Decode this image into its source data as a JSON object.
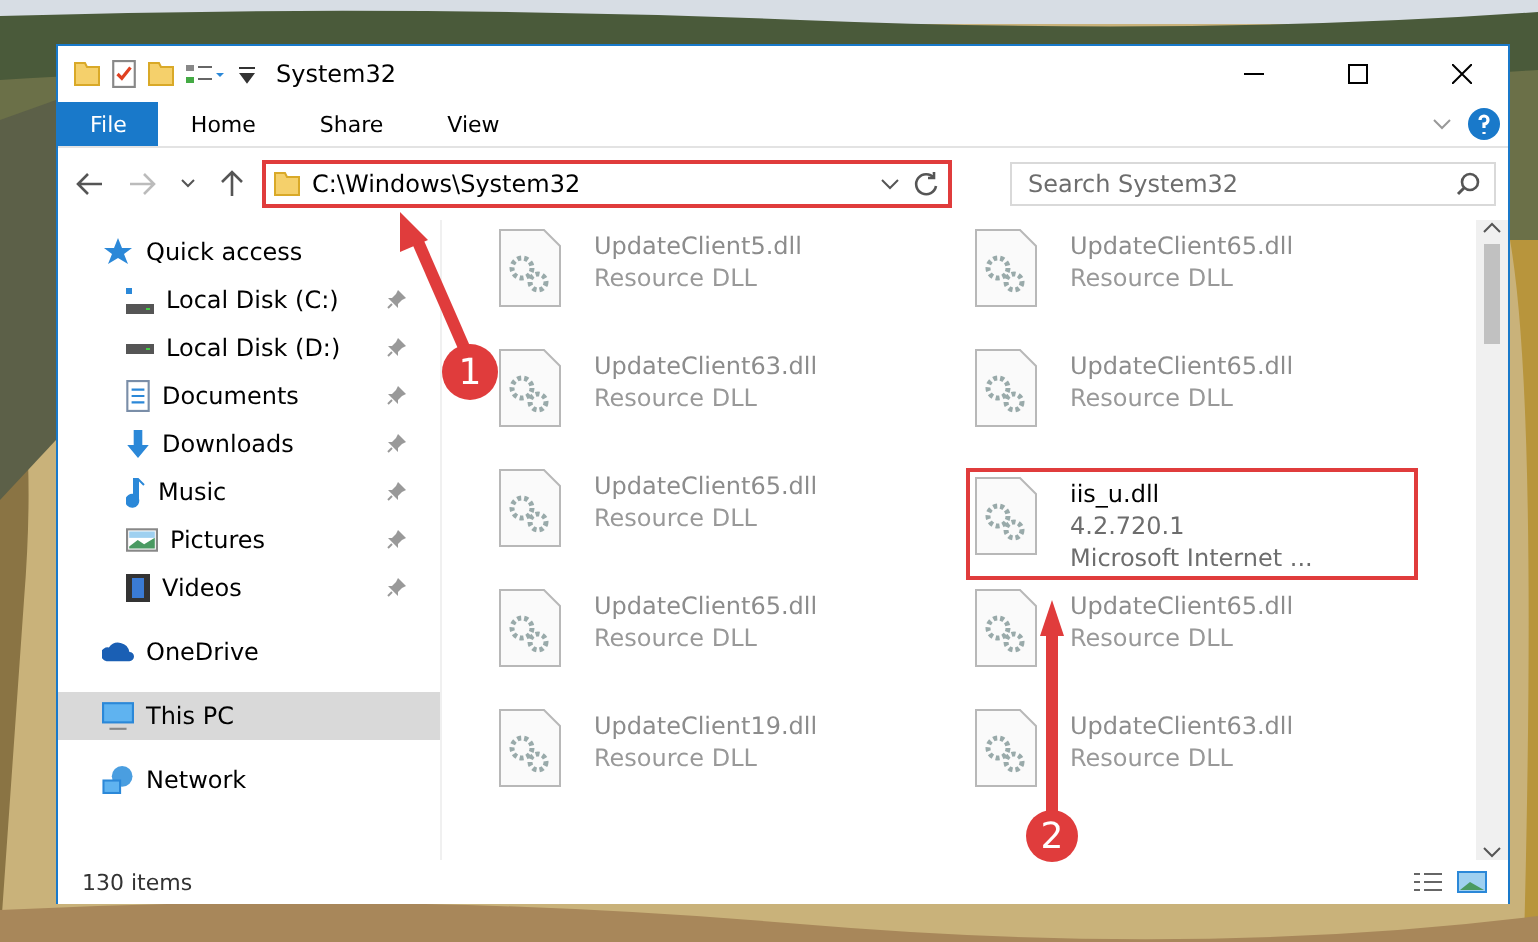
{
  "window": {
    "title": "System32"
  },
  "ribbon_tabs": [
    {
      "label": "File",
      "selected": true
    },
    {
      "label": "Home",
      "selected": false
    },
    {
      "label": "Share",
      "selected": false
    },
    {
      "label": "View",
      "selected": false
    }
  ],
  "address": {
    "value": "C:\\Windows\\System32",
    "highlighted": true
  },
  "search": {
    "placeholder": "Search System32"
  },
  "sidebar": {
    "items": [
      {
        "label": "Quick access",
        "selected": false,
        "children": [
          {
            "label": "Local Disk (C:)",
            "pinned": true,
            "selected": false
          },
          {
            "label": "Local Disk (D:)",
            "pinned": true,
            "selected": false
          },
          {
            "label": "Documents",
            "pinned": true,
            "selected": false
          },
          {
            "label": "Downloads",
            "pinned": true,
            "selected": false
          },
          {
            "label": "Music",
            "pinned": true,
            "selected": false
          },
          {
            "label": "Pictures",
            "pinned": true,
            "selected": false
          },
          {
            "label": "Videos",
            "pinned": true,
            "selected": false
          }
        ]
      },
      {
        "label": "OneDrive",
        "selected": false
      },
      {
        "label": "This PC",
        "selected": true
      },
      {
        "label": "Network",
        "selected": false
      }
    ]
  },
  "files": [
    {
      "name": "UpdateClient5.dll",
      "line_2": "Resource DLL",
      "blurred": true,
      "highlighted": false
    },
    {
      "name": "UpdateClient65.dll",
      "line_2": "Resource DLL",
      "blurred": true,
      "highlighted": false
    },
    {
      "name": "UpdateClient63.dll",
      "line_2": "Resource DLL",
      "blurred": true,
      "highlighted": false
    },
    {
      "name": "UpdateClient65.dll",
      "line_2": "Resource DLL",
      "blurred": true,
      "highlighted": false
    },
    {
      "name": "UpdateClient65.dll",
      "line_2": "Resource DLL",
      "blurred": true,
      "highlighted": false
    },
    {
      "name": "iis_u.dll",
      "line_2": "4.2.720.1",
      "line_3": "Microsoft Internet ...",
      "blurred": false,
      "highlighted": true
    },
    {
      "name": "UpdateClient65.dll",
      "line_2": "Resource DLL",
      "blurred": true,
      "highlighted": false
    },
    {
      "name": "UpdateClient65.dll",
      "line_2": "Resource DLL",
      "blurred": true,
      "highlighted": false
    },
    {
      "name": "UpdateClient19.dll",
      "line_2": "Resource DLL",
      "blurred": true,
      "highlighted": false
    },
    {
      "name": "UpdateClient63.dll",
      "line_2": "Resource DLL",
      "blurred": true,
      "highlighted": false
    }
  ],
  "status_bar": {
    "item_count": "130 items"
  },
  "annotations": [
    {
      "label": "1"
    },
    {
      "label": "2"
    }
  ]
}
